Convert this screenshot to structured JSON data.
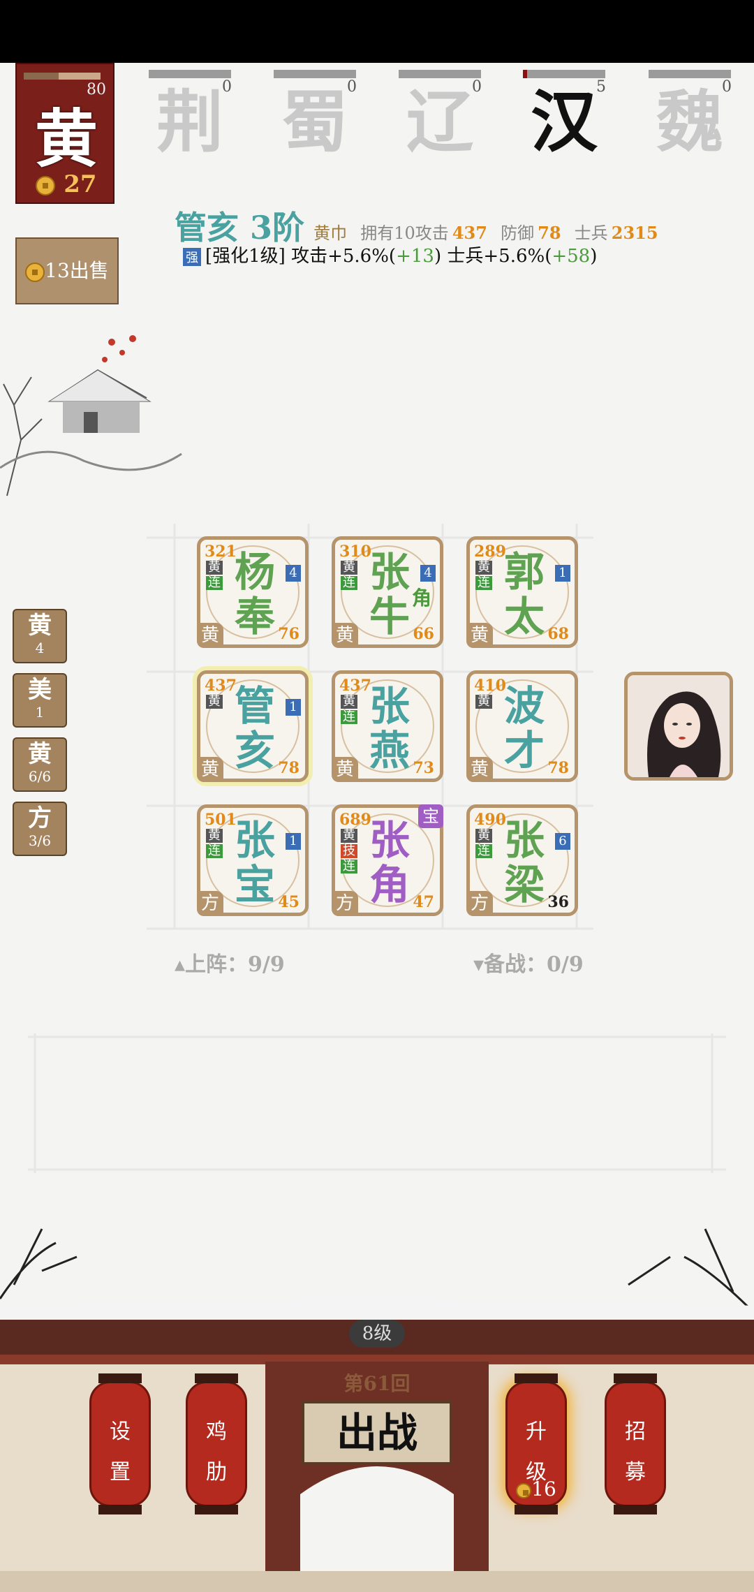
{
  "faction_card": {
    "glyph": "黄",
    "progress_value": "80",
    "progress": 0.45,
    "coins": "27"
  },
  "faction_tabs": [
    {
      "name": "荆",
      "count": "0",
      "fill": 0
    },
    {
      "name": "蜀",
      "count": "0",
      "fill": 0
    },
    {
      "name": "辽",
      "count": "0",
      "fill": 0
    },
    {
      "name": "汉",
      "count": "5",
      "fill": 0.05
    },
    {
      "name": "魏",
      "count": "0",
      "fill": 0
    }
  ],
  "hero": {
    "name": "管亥 3阶",
    "faction": "黄巾",
    "own_label": "拥有10",
    "atk_label": "攻击",
    "atk": "437",
    "def_label": "防御",
    "def": "78",
    "soldier_label": "士兵",
    "soldier": "2315",
    "buff_badge": "强",
    "buff_text": "[强化1级] 攻击+5.6%(",
    "buff_atk": "+13",
    "buff_mid": ") 士兵+5.6%(",
    "buff_soldier": "+58",
    "buff_end": ")"
  },
  "sell_button": {
    "label": "13出售"
  },
  "side_tags": [
    {
      "main": "黄",
      "sub": "4"
    },
    {
      "main": "美",
      "sub": "1"
    },
    {
      "main": "黄",
      "sub": "6/6"
    },
    {
      "main": "方",
      "sub": "3/6"
    }
  ],
  "cards": [
    {
      "name1": "杨",
      "name2": "奉",
      "atk": "321",
      "lvl": "4",
      "tags": [
        "黄",
        "连"
      ],
      "fac": "黄",
      "hp": "76",
      "color": "#5fa352"
    },
    {
      "name1": "张",
      "name2": "牛",
      "atk": "310",
      "lvl": "4",
      "tags": [
        "黄",
        "连"
      ],
      "fac": "黄",
      "hp": "66",
      "color": "#5fa352",
      "extra": "角"
    },
    {
      "name1": "郭",
      "name2": "太",
      "atk": "289",
      "lvl": "1",
      "tags": [
        "黄",
        "连"
      ],
      "fac": "黄",
      "hp": "68",
      "color": "#5fa352"
    },
    {
      "name1": "管",
      "name2": "亥",
      "atk": "437",
      "lvl": "1",
      "tags": [
        "黄"
      ],
      "fac": "黄",
      "hp": "78",
      "color": "#4aa2a0"
    },
    {
      "name1": "张",
      "name2": "燕",
      "atk": "437",
      "lvl": "",
      "tags": [
        "黄",
        "连"
      ],
      "fac": "黄",
      "hp": "73",
      "color": "#4aa2a0"
    },
    {
      "name1": "波",
      "name2": "才",
      "atk": "410",
      "lvl": "",
      "tags": [
        "黄"
      ],
      "fac": "黄",
      "hp": "78",
      "color": "#4aa2a0"
    },
    {
      "name1": "张",
      "name2": "宝",
      "atk": "501",
      "lvl": "1",
      "tags": [
        "黄",
        "连"
      ],
      "fac": "方",
      "hp": "45",
      "color": "#4aa2a0"
    },
    {
      "name1": "张",
      "name2": "角",
      "atk": "689",
      "lvl": "",
      "tags": [
        "黄",
        "技",
        "连"
      ],
      "fac": "方",
      "hp": "47",
      "color": "#a05ec4",
      "treasure": "宝"
    },
    {
      "name1": "张",
      "name2": "梁",
      "atk": "490",
      "lvl": "6",
      "tags": [
        "黄",
        "连"
      ],
      "fac": "方",
      "hp": "36",
      "color": "#5fa352"
    }
  ],
  "counters": {
    "deployed": "▴上阵：9/9",
    "reserve": "▾备战：0/9"
  },
  "bottom": {
    "level": "8级",
    "round": "第61回",
    "battle": "出战",
    "settings": [
      "设",
      "置"
    ],
    "rib": [
      "鸡",
      "肋"
    ],
    "upgrade": [
      "升",
      "级"
    ],
    "upgrade_cost": "16",
    "recruit": [
      "招",
      "募"
    ]
  }
}
